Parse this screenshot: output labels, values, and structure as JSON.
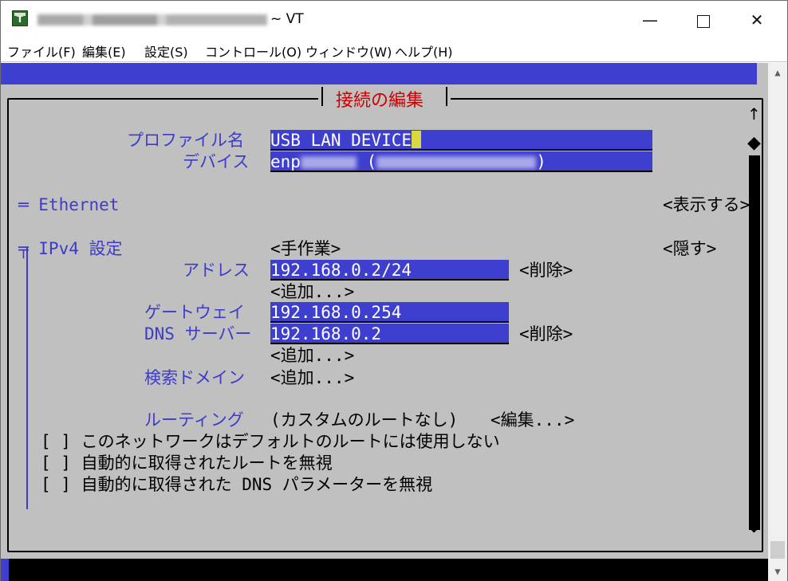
{
  "titlebar": {
    "title_suffix": "~ VT",
    "icon_letter": "T",
    "minimize": "—",
    "close": "✕"
  },
  "menu": [
    {
      "label": "ファイル(F)"
    },
    {
      "label": "編集(E)"
    },
    {
      "label": "設定(S)"
    },
    {
      "label": "コントロール(O)"
    },
    {
      "label": "ウィンドウ(W)"
    },
    {
      "label": "ヘルプ(H)"
    }
  ],
  "dialog": {
    "title": "接続の編集",
    "profile_label": "プロファイル名",
    "profile_value": "USB LAN DEVICE",
    "device_label": "デバイス",
    "device_prefix": "enp",
    "device_middle": " (",
    "device_suffix": ")",
    "ethernet_label": "═ Ethernet",
    "ethernet_action": "<表示する>",
    "ipv4_label": "╤ IPv4 設定",
    "ipv4_method": "<手作業>",
    "ipv4_hide": "<隠す>",
    "address_label": "アドレス",
    "address_value": "192.168.0.2/24",
    "address_delete": "<削除>",
    "address_add": "<追加...>",
    "gateway_label": "ゲートウェイ",
    "gateway_value": "192.168.0.254",
    "dns_label": "DNS サーバー",
    "dns_value": "192.168.0.2",
    "dns_delete": "<削除>",
    "dns_add": "<追加...>",
    "search_label": "検索ドメイン",
    "search_add": "<追加...>",
    "routing_label": "ルーティング",
    "routing_value": "(カスタムのルートなし)",
    "routing_edit": "<編集...>",
    "checkbox1": "[ ] このネットワークはデフォルトのルートには使用しない",
    "checkbox2": "[ ] 自動的に取得されたルートを無視",
    "checkbox3": "[ ] 自動的に取得された DNS パラメーターを無視"
  },
  "scroll": {
    "up": "↑",
    "down": "↓",
    "thumb": "◆"
  },
  "window_scroll": {
    "up": "▲",
    "down": "▼"
  }
}
